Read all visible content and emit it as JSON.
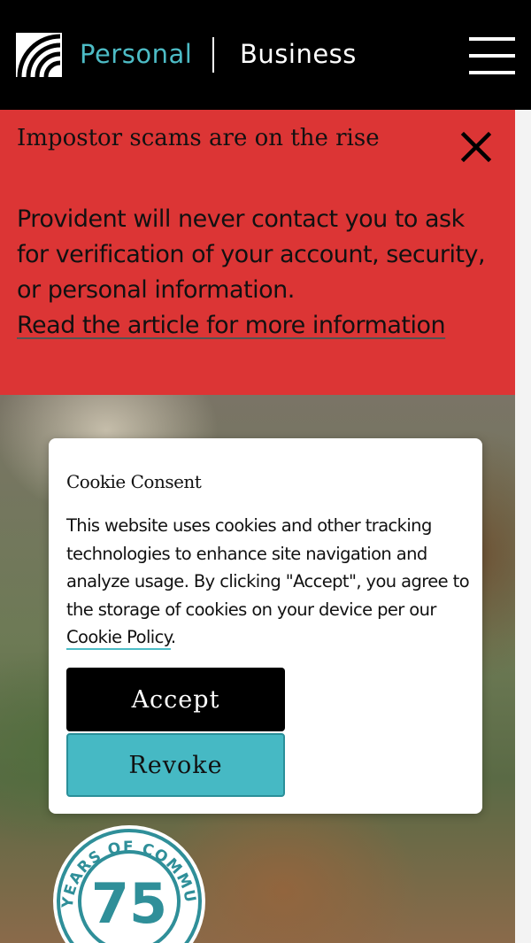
{
  "header": {
    "tab_personal": "Personal",
    "tab_business": "Business",
    "brand_accent": "#4dbcc6",
    "logo_icon": "wave-arcs-logo-icon",
    "menu_icon": "hamburger-icon"
  },
  "alert": {
    "title": "Impostor scams are on the rise",
    "body": "Provident will never contact you to ask for verification of your account, security, or personal information.",
    "link_text": "Read the article for more information",
    "background": "#dc3535",
    "close_icon": "close-icon"
  },
  "cookie": {
    "title": "Cookie Consent",
    "text_before_link": "This website uses cookies and other tracking technologies to enhance site navigation and analyze usage. By clicking \"Accept\", you agree to the storage of cookies on your device per our ",
    "link_text": "Cookie Policy",
    "text_after_link": ".",
    "accept_label": "Accept",
    "revoke_label": "Revoke"
  },
  "badge": {
    "number": "75",
    "ring_text": "YEARS OF COMMUNITY"
  }
}
